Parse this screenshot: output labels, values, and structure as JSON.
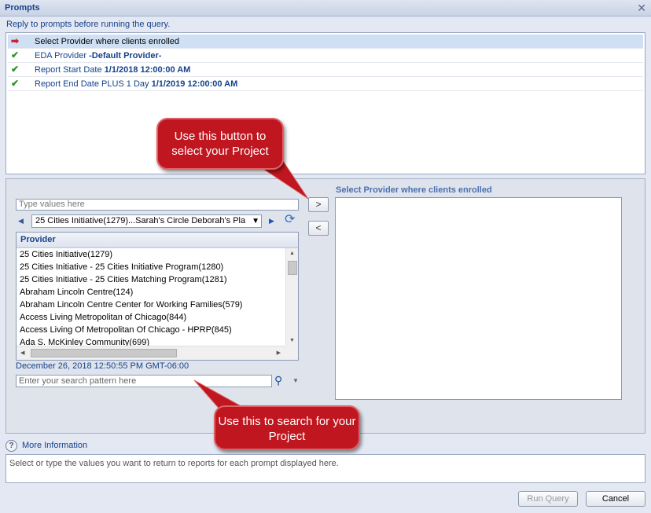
{
  "window": {
    "title": "Prompts",
    "close_glyph": "✕"
  },
  "reply_text": "Reply to prompts before running the query.",
  "prompts": [
    {
      "icon": "red-arrow",
      "label": "Select Provider where clients enrolled",
      "value": ""
    },
    {
      "icon": "green-check",
      "label": "EDA Provider ",
      "value": "-Default Provider-"
    },
    {
      "icon": "green-check",
      "label": "Report Start Date ",
      "value": "1/1/2018 12:00:00 AM"
    },
    {
      "icon": "green-check",
      "label": "Report End Date PLUS 1 Day ",
      "value": "1/1/2019 12:00:00 AM"
    }
  ],
  "left_panel": {
    "type_placeholder": "Type values here",
    "combo_value": "25 Cities Initiative(1279)...Sarah's Circle Deborah's Pla",
    "list_header": "Provider",
    "items": [
      "25 Cities Initiative(1279)",
      "25 Cities Initiative - 25 Cities Initiative Program(1280)",
      "25 Cities Initiative - 25 Cities Matching Program(1281)",
      "Abraham Lincoln Centre(124)",
      "Abraham Lincoln Centre Center for Working Families(579)",
      "Access Living Metropolitan of Chicago(844)",
      "Access Living Of Metropolitan Of Chicago - HPRP(845)",
      "Ada S. McKinley Community(699)"
    ],
    "timestamp": "December 26, 2018 12:50:55 PM GMT-06:00",
    "search_placeholder": "Enter your search pattern here"
  },
  "transfer": {
    "add": ">",
    "remove": "<"
  },
  "right_panel": {
    "title": "Select Provider where clients enrolled"
  },
  "callouts": {
    "button_callout": "Use this button to select your Project",
    "search_callout": "Use this to search for your Project"
  },
  "more_info": {
    "label": "More Information",
    "text": "Select or type the values you want to return to reports for each prompt displayed here."
  },
  "buttons": {
    "run_query": "Run Query",
    "cancel": "Cancel"
  },
  "colors": {
    "callout": "#c0161f",
    "link": "#15428b",
    "selected_row": "#cfe0f5"
  }
}
